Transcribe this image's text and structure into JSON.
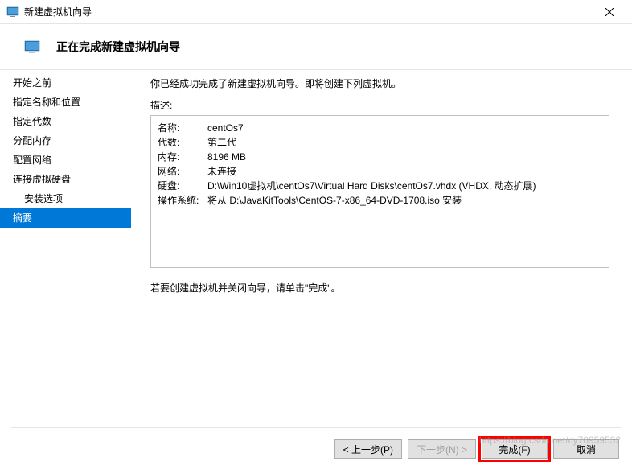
{
  "window": {
    "title": "新建虚拟机向导"
  },
  "header": {
    "title": "正在完成新建虚拟机向导"
  },
  "sidebar": {
    "items": [
      {
        "label": "开始之前"
      },
      {
        "label": "指定名称和位置"
      },
      {
        "label": "指定代数"
      },
      {
        "label": "分配内存"
      },
      {
        "label": "配置网络"
      },
      {
        "label": "连接虚拟硬盘"
      },
      {
        "label": "安装选项"
      },
      {
        "label": "摘要"
      }
    ]
  },
  "main": {
    "intro": "你已经成功完成了新建虚拟机向导。即将创建下列虚拟机。",
    "desc_label": "描述:",
    "rows": [
      {
        "key": "名称:",
        "val": "centOs7"
      },
      {
        "key": "代数:",
        "val": "第二代"
      },
      {
        "key": "内存:",
        "val": "8196 MB"
      },
      {
        "key": "网络:",
        "val": "未连接"
      },
      {
        "key": "硬盘:",
        "val": "D:\\Win10虚拟机\\centOs7\\Virtual Hard Disks\\centOs7.vhdx (VHDX, 动态扩展)"
      },
      {
        "key": "操作系统:",
        "val": "将从 D:\\JavaKitTools\\CentOS-7-x86_64-DVD-1708.iso 安装"
      }
    ],
    "footer": "若要创建虚拟机并关闭向导，请单击\"完成\"。"
  },
  "buttons": {
    "prev": "< 上一步(P)",
    "next": "下一步(N) >",
    "finish": "完成(F)",
    "cancel": "取消"
  },
  "watermark": "https://blog.csdn.net/cy70959532"
}
